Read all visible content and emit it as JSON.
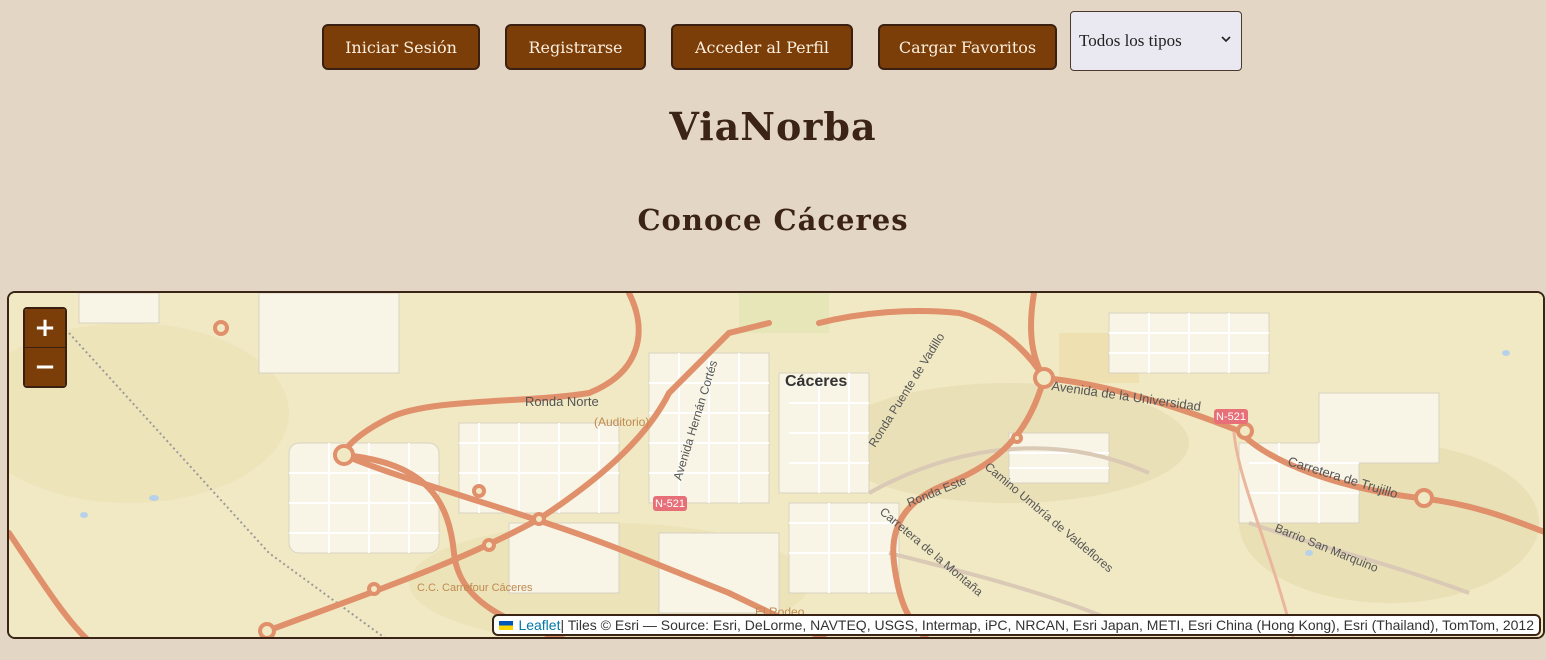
{
  "nav": {
    "login": "Iniciar Sesión",
    "register": "Registrarse",
    "profile": "Acceder al Perfil",
    "favorites": "Cargar Favoritos",
    "type_filter": "Todos los tipos"
  },
  "header": {
    "title": "ViaNorba",
    "subtitle": "Conoce Cáceres"
  },
  "map": {
    "zoom_in": "+",
    "zoom_out": "−",
    "labels": {
      "city": "Cáceres",
      "ronda_norte": "Ronda Norte",
      "auditorio": "(Auditorio)",
      "hernan_cortes": "Avenida Hernán Cortés",
      "puente_vadillo": "Ronda Puente de Vadillo",
      "universidad": "Avenida de la Universidad",
      "n521": "N-521",
      "trujillo": "Carretera de Trujillo",
      "ronda_este": "Ronda Este",
      "umbria": "Camino Umbría de Valdeflores",
      "montana": "Carretera de la Montaña",
      "san_marquino": "Barrio San Marquino",
      "carrefour": "C.C. Carrefour Cáceres",
      "el_rodeo": "El Rodeo"
    },
    "attribution": {
      "leaflet": "Leaflet",
      "text": " | Tiles © Esri — Source: Esri, DeLorme, NAVTEQ, USGS, Intermap, iPC, NRCAN, Esri Japan, METI, Esri China (Hong Kong), Esri (Thailand), TomTom, 2012"
    }
  },
  "colors": {
    "background": "#e3d6c4",
    "button": "#7b3e09",
    "text": "#3b2416",
    "road_major": "#e0906a",
    "map_base": "#f1e9c4"
  }
}
